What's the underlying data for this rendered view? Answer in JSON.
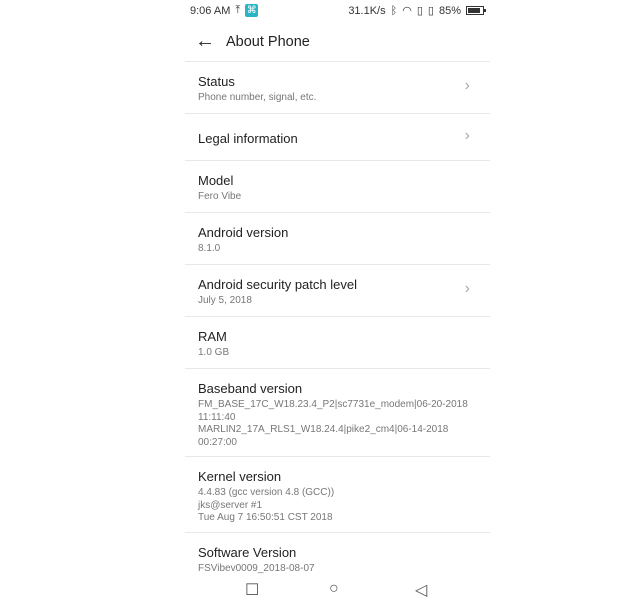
{
  "status_bar": {
    "time": "9:06 AM",
    "speed": "31.1K/s",
    "battery": "85%",
    "battery_level": 0.85,
    "icons": [
      "upload-icon",
      "app-icon",
      "bluetooth-icon",
      "wifi-icon",
      "sim1-icon",
      "sim2-icon",
      "battery-icon"
    ]
  },
  "header": {
    "title": "About Phone"
  },
  "items": [
    {
      "title": "Status",
      "subtitle": "Phone number, signal, etc.",
      "chevron": true
    },
    {
      "title": "Legal information",
      "subtitle": "",
      "chevron": true
    },
    {
      "title": "Model",
      "subtitle": "Fero Vibe",
      "chevron": false
    },
    {
      "title": "Android version",
      "subtitle": "8.1.0",
      "chevron": false
    },
    {
      "title": "Android security patch level",
      "subtitle": "July 5, 2018",
      "chevron": true
    },
    {
      "title": "RAM",
      "subtitle": "1.0 GB",
      "chevron": false
    },
    {
      "title": "Baseband version",
      "subtitle": "FM_BASE_17C_W18.23.4_P2|sc7731e_modem|06-20-2018\n11:11:40\nMARLIN2_17A_RLS1_W18.24.4|pike2_cm4|06-14-2018\n00:27:00",
      "chevron": false
    },
    {
      "title": "Kernel version",
      "subtitle": "4.4.83 (gcc version 4.8 (GCC))\njks@server #1\nTue Aug 7 16:50:51 CST 2018",
      "chevron": false
    },
    {
      "title": "Software Version",
      "subtitle": "FSVibev0009_2018-08-07",
      "chevron": false
    }
  ],
  "nav": {
    "icons": [
      "recents-icon",
      "home-icon",
      "back-icon"
    ]
  }
}
